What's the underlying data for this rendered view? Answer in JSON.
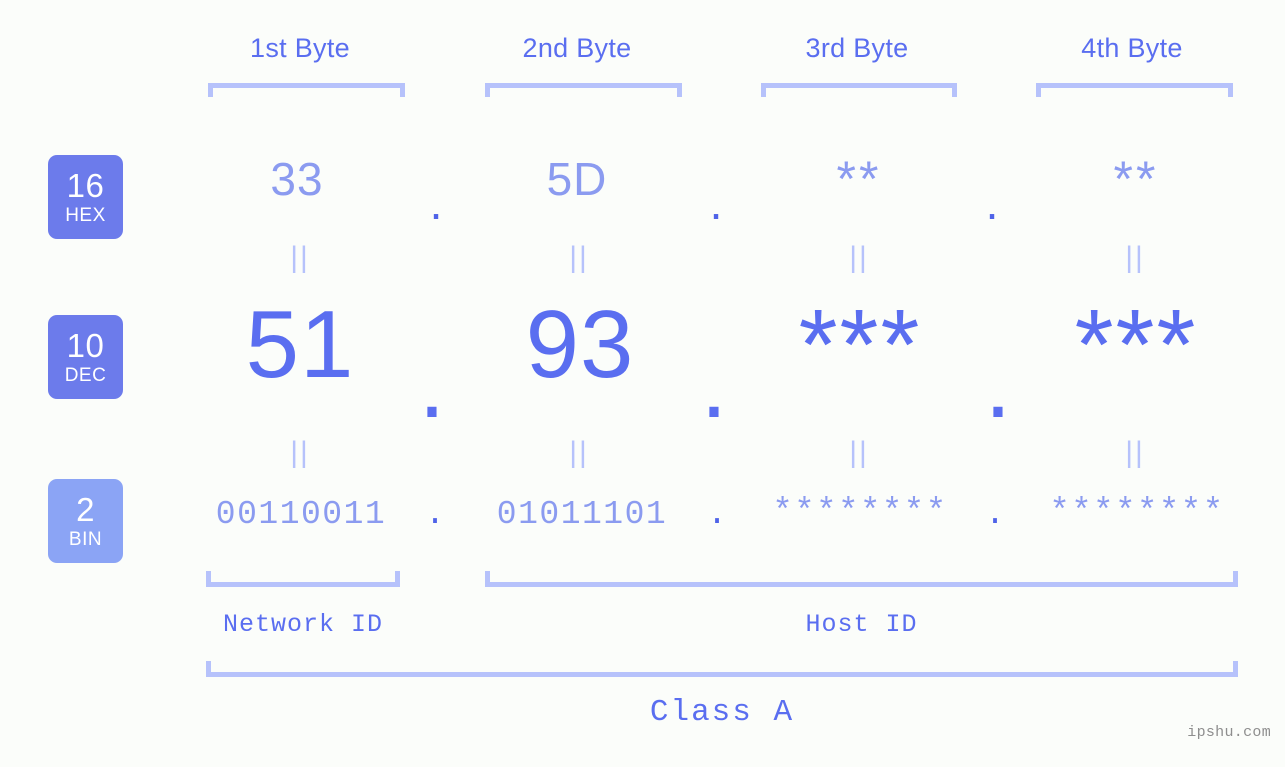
{
  "background_color": "#fbfdfa",
  "colors": {
    "accent_dark": "#5a6ef0",
    "accent_light": "#8b9bf0",
    "bracket": "#b6c2fb",
    "badge_strong": "#6c7beb",
    "badge_soft": "#8ba4f5",
    "dot": "#4f63e8",
    "watermark": "#8e8e8e"
  },
  "byte_headers": [
    {
      "label": "1st Byte"
    },
    {
      "label": "2nd Byte"
    },
    {
      "label": "3rd Byte"
    },
    {
      "label": "4th Byte"
    }
  ],
  "rows": [
    {
      "badge_num": "16",
      "badge_sys": "HEX",
      "values": [
        "33",
        "5D",
        "**",
        "**"
      ],
      "separator": "."
    },
    {
      "badge_num": "10",
      "badge_sys": "DEC",
      "values": [
        "51",
        "93",
        "***",
        "***"
      ],
      "separator": "."
    },
    {
      "badge_num": "2",
      "badge_sys": "BIN",
      "values": [
        "00110011",
        "01011101",
        "********",
        "********"
      ],
      "separator": "."
    }
  ],
  "equals_symbol": "||",
  "segments": {
    "network_id_label": "Network ID",
    "host_id_label": "Host ID"
  },
  "class_label": "Class A",
  "watermark": "ipshu.com"
}
